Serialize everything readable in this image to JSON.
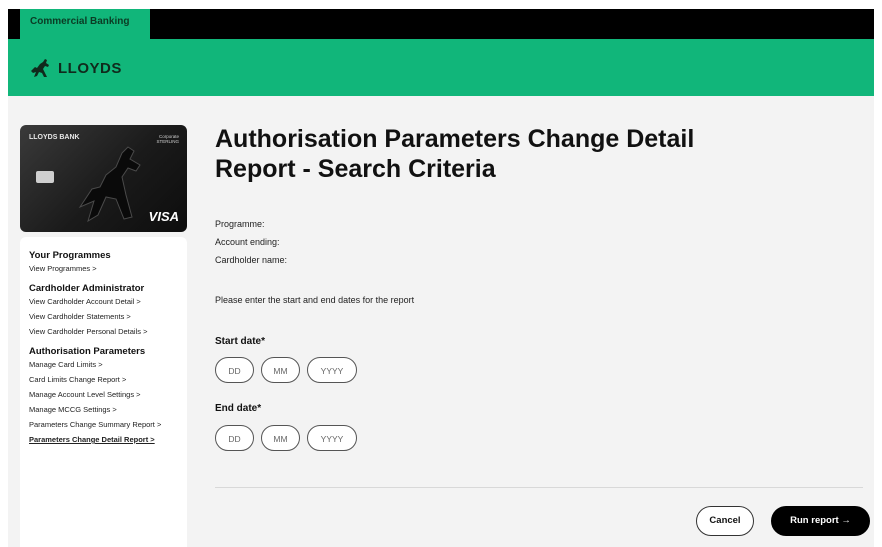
{
  "topbar": {
    "tab_label": "Commercial Banking"
  },
  "brand": {
    "logo_text": "LLOYDS"
  },
  "card": {
    "bank_name": "LLOYDS BANK",
    "corporate_label": "Corporate STERLING",
    "scheme": "VISA"
  },
  "sidebar": {
    "sections": [
      {
        "heading": "Your Programmes",
        "links": [
          "View Programmes >"
        ]
      },
      {
        "heading": "Cardholder Administrator",
        "links": [
          "View Cardholder Account Detail >",
          "View Cardholder Statements >",
          "View Cardholder Personal Details >"
        ]
      },
      {
        "heading": "Authorisation Parameters",
        "links": [
          "Manage Card Limits >",
          "Card Limits Change Report >",
          "Manage Account Level Settings >",
          "Manage MCCG Settings >",
          "Parameters Change Summary Report >",
          "Parameters Change Detail Report >"
        ]
      }
    ]
  },
  "main": {
    "title_line1": "Authorisation Parameters Change Detail",
    "title_line2": "Report - Search Criteria",
    "programme_label": "Programme:",
    "account_label": "Account ending:",
    "cardholder_label": "Cardholder name:",
    "instructions": "Please enter the start and end dates for the report",
    "start_date_label": "Start date*",
    "end_date_label": "End date*",
    "date_placeholders": {
      "day": "DD",
      "month": "MM",
      "year": "YYYY"
    },
    "cancel_label": "Cancel",
    "run_label": "Run report →"
  },
  "colors": {
    "brand_green": "#11b67a",
    "black": "#000000",
    "page_bg": "#f3f3f3"
  }
}
